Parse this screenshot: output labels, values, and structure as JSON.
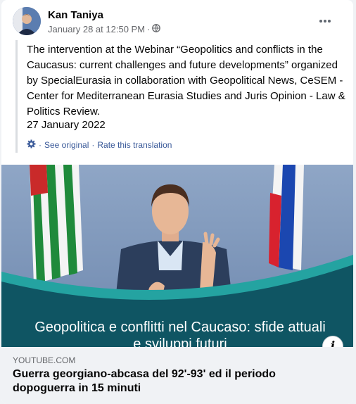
{
  "post": {
    "author": "Kan Taniya",
    "timestamp": "January 28 at 12:50 PM",
    "separator": "·",
    "privacy_icon": "globe-icon",
    "more_icon": "more-options-icon",
    "text": "The intervention at the Webinar “Geopolitics and conflicts in the Caucasus: current challenges and future developments” organized by SpecialEurasia in collaboration with Geopolitical News, CeSEM - Center for Mediterranean Eurasia Studies and Juris Opinion - Law & Politics Review.",
    "date": "27 January 2022",
    "translation": {
      "icon": "gear-icon",
      "see_original": "See original",
      "separator": "·",
      "rate": "Rate this translation"
    }
  },
  "video": {
    "caption": "Geopolitica e conflitti nel Caucaso: sfide attuali e sviluppi futuri",
    "info_label": "i"
  },
  "link": {
    "domain": "YOUTUBE.COM",
    "title": "Guerra georgiano-abcasa del 92'-93' ed il periodo dopoguerra in 15 minuti"
  },
  "colors": {
    "link_blue": "#385898",
    "teal_band": "#1b6f7c",
    "flag_green": "#1f8a3b",
    "flag_red": "#d8222e",
    "flag_blue": "#1b47b0"
  }
}
